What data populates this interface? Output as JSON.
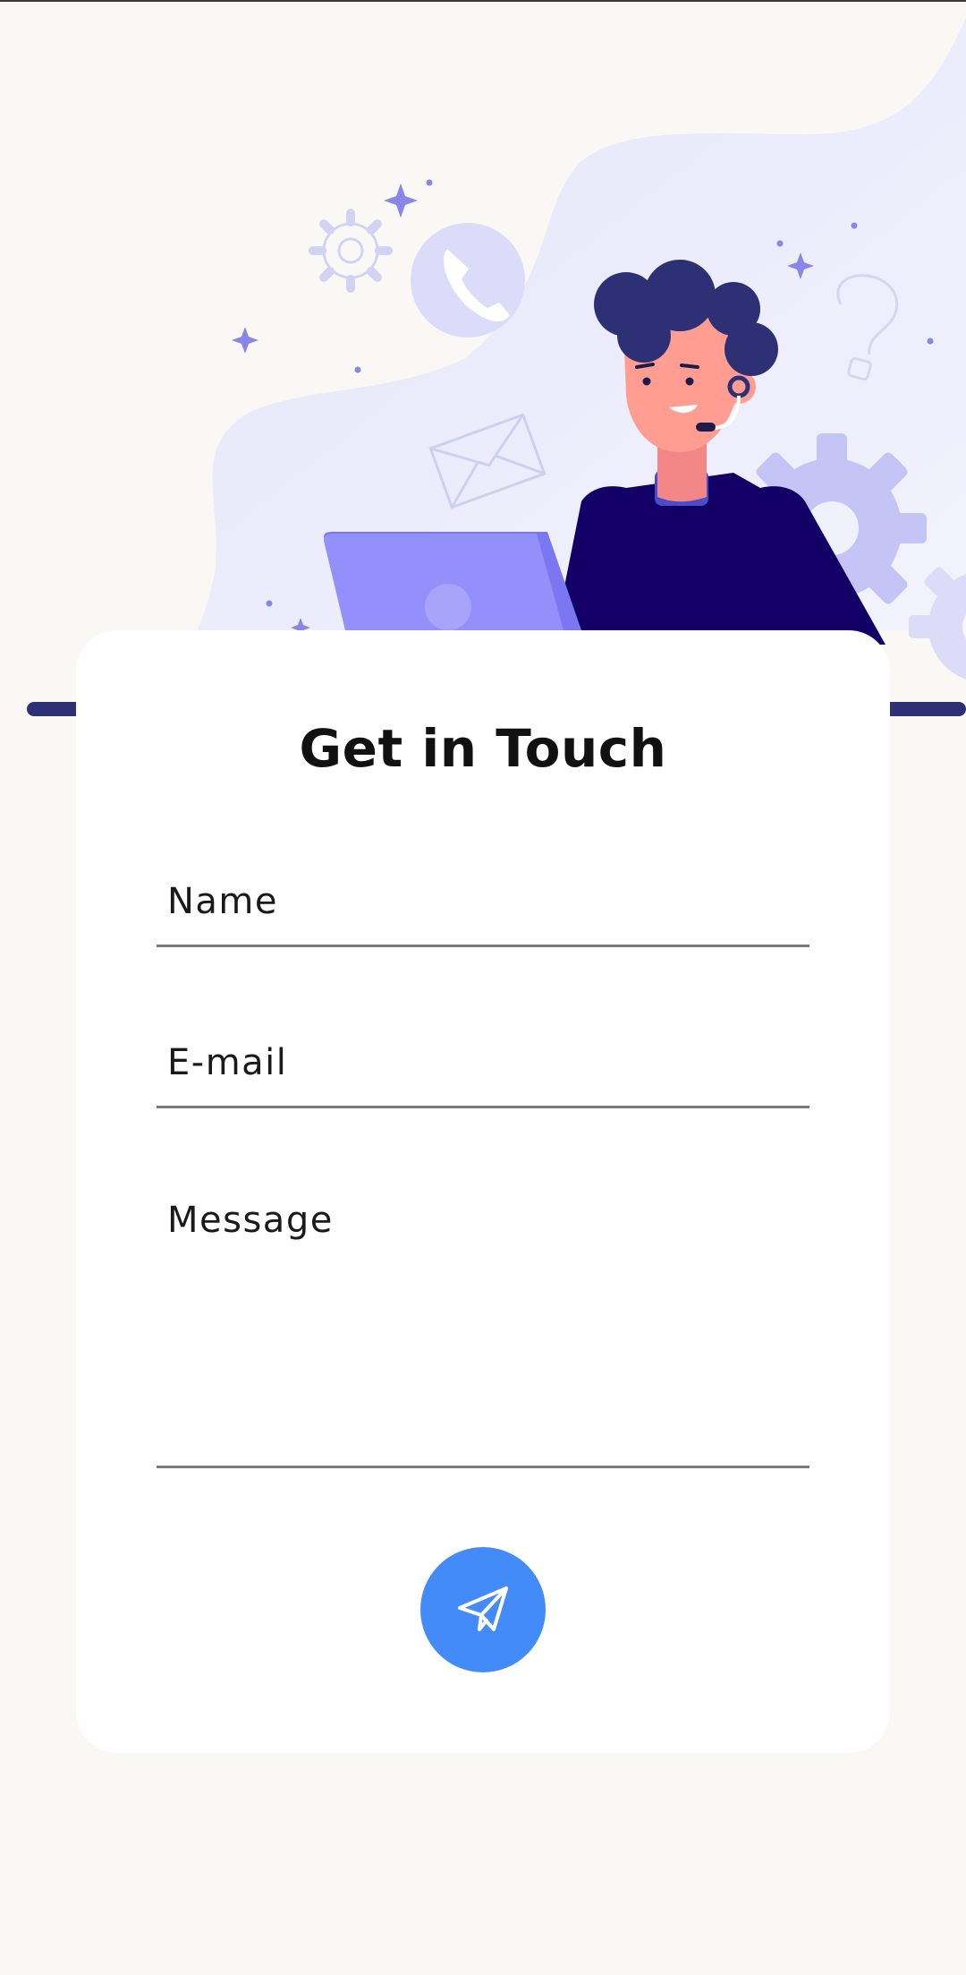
{
  "form": {
    "title": "Get in Touch",
    "name_placeholder": "Name",
    "email_placeholder": "E-mail",
    "message_placeholder": "Message",
    "send_icon": "paper-plane-icon"
  },
  "colors": {
    "background": "#f9f8f5",
    "card": "#ffffff",
    "send_button": "#448bfa",
    "accent_navy": "#2e3076",
    "shirt": "#120066",
    "laptop": "#9490fb",
    "gear": "#c5c4f6",
    "blob": "#e9e9fb"
  }
}
